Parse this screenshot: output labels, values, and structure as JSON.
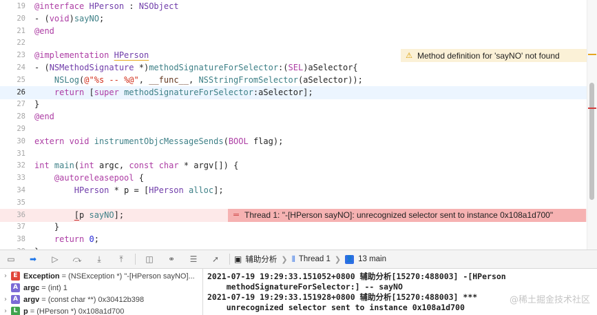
{
  "editor": {
    "lines": [
      {
        "num": "19",
        "state": "normal",
        "html": "<span class='k'>@interface</span> <span class='t'>HPerson</span> : <span class='t'>NSObject</span>"
      },
      {
        "num": "20",
        "state": "normal",
        "html": "- (<span class='k'>void</span>)<span class='m'>sayNO</span>;"
      },
      {
        "num": "21",
        "state": "normal",
        "html": "<span class='k'>@end</span>"
      },
      {
        "num": "22",
        "state": "normal",
        "html": ""
      },
      {
        "num": "23",
        "state": "normal",
        "html": "<span class='k'>@implementation</span> <span class='t warn-mark'>HPerson</span>"
      },
      {
        "num": "24",
        "state": "normal",
        "html": "- (<span class='t'>NSMethodSignature</span> *)<span class='m'>methodSignatureForSelector</span>:(<span class='k'>SEL</span>)aSelector{"
      },
      {
        "num": "25",
        "state": "normal",
        "html": "    <span class='f'>NSLog</span>(<span class='s'>@\"%s -- %@\"</span>, <span class='pp'>__func__</span>, <span class='f'>NSStringFromSelector</span>(aSelector));"
      },
      {
        "num": "26",
        "state": "current",
        "html": "    <span class='k'>return</span> [<span class='k'>super</span> <span class='f'>methodSignatureForSelector</span>:aSelector];"
      },
      {
        "num": "27",
        "state": "normal",
        "html": "}"
      },
      {
        "num": "28",
        "state": "normal",
        "html": "<span class='k'>@end</span>"
      },
      {
        "num": "29",
        "state": "normal",
        "html": ""
      },
      {
        "num": "30",
        "state": "normal",
        "html": "<span class='k'>extern</span> <span class='k'>void</span> <span class='f'>instrumentObjcMessageSends</span>(<span class='k'>BOOL</span> flag);"
      },
      {
        "num": "31",
        "state": "normal",
        "html": ""
      },
      {
        "num": "32",
        "state": "normal",
        "html": "<span class='k'>int</span> <span class='f'>main</span>(<span class='k'>int</span> argc, <span class='k'>const</span> <span class='k'>char</span> * argv[]) {"
      },
      {
        "num": "33",
        "state": "normal",
        "html": "    <span class='k'>@autoreleasepool</span> {"
      },
      {
        "num": "34",
        "state": "normal",
        "html": "        <span class='t'>HPerson</span> * p = [<span class='t'>HPerson</span> <span class='f'>alloc</span>];"
      },
      {
        "num": "35",
        "state": "normal",
        "html": ""
      },
      {
        "num": "36",
        "state": "error",
        "html": "        <span class='caret'>[</span>p <span class='m'>sayNO</span>];"
      },
      {
        "num": "37",
        "state": "normal",
        "html": "    }"
      },
      {
        "num": "38",
        "state": "normal",
        "html": "    <span class='k'>return</span> <span class='n'>0</span>;"
      },
      {
        "num": "39",
        "state": "normal",
        "html": "}"
      }
    ],
    "warning": {
      "line": "23",
      "icon": "⚠",
      "text": "Method definition for 'sayNO' not found"
    },
    "error": {
      "line": "36",
      "icon": "═",
      "text": "Thread 1: \"-[HPerson sayNO]: unrecognized selector sent to instance 0x108a1d700\""
    }
  },
  "debug_toolbar": {
    "buttons": [
      {
        "name": "hide-debug-area-button",
        "icon": "▭",
        "active": false
      },
      {
        "name": "breakpoints-toggle-button",
        "icon": "➡",
        "active": true
      },
      {
        "name": "continue-button",
        "icon": "▷",
        "active": false
      },
      {
        "name": "step-over-button",
        "icon": "⤼",
        "active": false
      },
      {
        "name": "step-into-button",
        "icon": "⤓",
        "active": false
      },
      {
        "name": "step-out-button",
        "icon": "⤒",
        "active": false
      },
      {
        "name": "view-hierarchy-button",
        "icon": "◫",
        "active": false
      },
      {
        "name": "memory-graph-button",
        "icon": "⚭",
        "active": false
      },
      {
        "name": "environment-overrides-button",
        "icon": "☰",
        "active": false
      },
      {
        "name": "simulate-location-button",
        "icon": "➚",
        "active": false
      }
    ],
    "breadcrumb": {
      "app": "辅助分析",
      "thread": "Thread 1",
      "frame": "13 main"
    }
  },
  "variables": [
    {
      "badge": "E",
      "badge_color": "#e0453a",
      "name": "Exception",
      "rest": "= (NSException *) \"-[HPerson sayNO]...",
      "expandable": true
    },
    {
      "badge": "A",
      "badge_color": "#7b6ad6",
      "name": "argc",
      "rest": "= (int) 1",
      "expandable": false
    },
    {
      "badge": "A",
      "badge_color": "#7b6ad6",
      "name": "argv",
      "rest": "= (const char **) 0x30412b398",
      "expandable": true
    },
    {
      "badge": "L",
      "badge_color": "#3fa34d",
      "name": "p",
      "rest": "= (HPerson *) 0x108a1d700",
      "expandable": true
    }
  ],
  "console": {
    "lines": [
      "2021-07-19 19:29:33.151052+0800 辅助分析[15270:488003] -[HPerson",
      "    methodSignatureForSelector:] -- sayNO",
      "2021-07-19 19:29:33.151928+0800 辅助分析[15270:488003] ***",
      "    unrecognized selector sent to instance 0x108a1d700"
    ],
    "watermark": "@稀土掘金技术社区"
  },
  "colors": {
    "current_line": "#ecf5ff",
    "error_line": "#fde9e9",
    "error_banner": "#f6b2b2",
    "warning_banner": "#fbf1d7"
  }
}
